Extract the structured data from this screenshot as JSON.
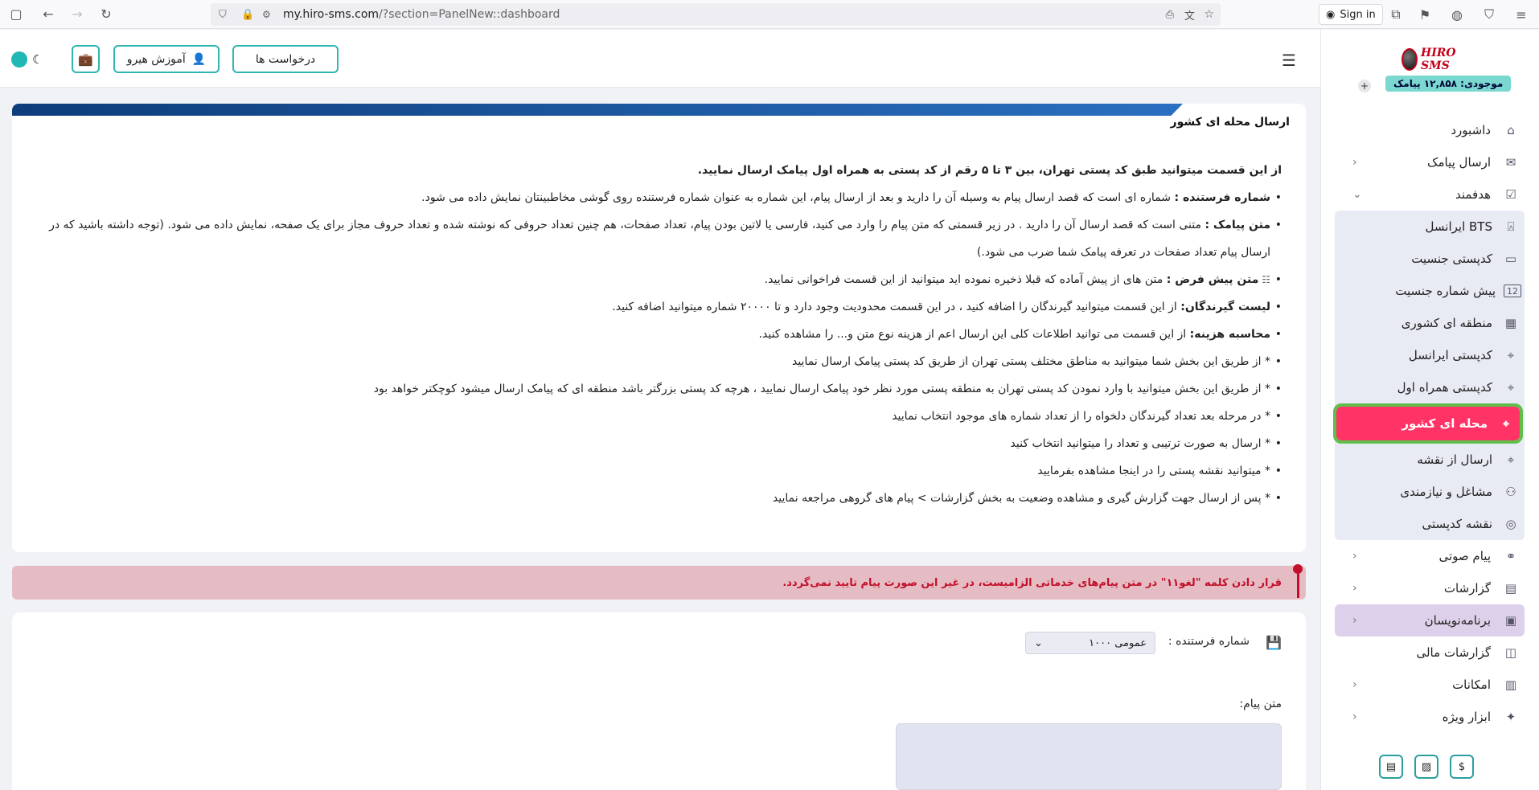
{
  "browser": {
    "url_host": "my.hiro-sms.com",
    "url_path": "/?section=PanelNew::dashboard",
    "signin_label": "Sign in"
  },
  "sidebar": {
    "logo_text": "HIRO SMS",
    "balance": "موجودی: ۱۲,۸۵۸ پیامک",
    "balance_plus": "+",
    "items": [
      {
        "label": "داشبورد",
        "icon": "home-icon"
      },
      {
        "label": "ارسال پیامک",
        "icon": "sms-icon"
      },
      {
        "label": "هدفمند",
        "icon": "target-icon"
      }
    ],
    "sub_items": [
      {
        "label": "BTS ایرانسل",
        "icon": "antenna-icon"
      },
      {
        "label": "کدپستی جنسیت",
        "icon": "id-card-icon"
      },
      {
        "label": "پیش شماره جنسیت",
        "icon": "number-icon"
      },
      {
        "label": "منطقه ای کشوری",
        "icon": "map-icon"
      },
      {
        "label": "کدپستی ایرانسل",
        "icon": "map-pin-icon"
      },
      {
        "label": "کدپستی همراه اول",
        "icon": "map-pin-icon"
      },
      {
        "label": "محله ای کشور",
        "icon": "map-pin-icon"
      },
      {
        "label": "ارسال از نقشه",
        "icon": "map-pin-icon"
      },
      {
        "label": "مشاغل و نیازمندی",
        "icon": "people-icon"
      },
      {
        "label": "نقشه کدپستی",
        "icon": "globe-icon"
      }
    ],
    "after_items": [
      {
        "label": "پیام صوتی",
        "icon": "voicemail-icon"
      },
      {
        "label": "گزارشات",
        "icon": "report-icon"
      },
      {
        "label": "برنامه‌نویسان",
        "icon": "code-icon"
      },
      {
        "label": "گزارشات مالی",
        "icon": "finance-icon"
      },
      {
        "label": "امکانات",
        "icon": "tools-icon"
      },
      {
        "label": "ابزار ویژه",
        "icon": "sparkle-icon"
      }
    ],
    "bottom_buttons": [
      "$"
    ]
  },
  "topbar": {
    "requests_label": "درخواست ها",
    "training_label": "آموزش هیرو"
  },
  "card1": {
    "title": "ارسال محله ای کشور",
    "lead": "از این قسمت میتوانید طبق کد پستی تهران، بین ۳ تا ۵ رقم از کد پستی به همراه اول پیامک ارسال نمایید.",
    "bullets": [
      {
        "b": "شماره فرستنده :",
        "t": " شماره ای است که قصد ارسال پیام به وسیله آن را دارید و بعد از ارسال پیام، این شماره به عنوان شماره فرستنده روی گوشی مخاطبینتان نمایش داده می شود."
      },
      {
        "b": "متن پیامک :",
        "t": " متنی است که قصد ارسال آن را دارید . در زیر قسمتی که متن پیام را وارد می کنید، فارسی یا لاتین بودن پیام، تعداد صفحات، هم چنین تعداد حروفی که نوشته شده و تعداد حروف مجاز برای یک صفحه، نمایش داده می شود. (توجه داشته باشید که در ارسال پیام تعداد صفحات در تعرفه پیامک شما ضرب می شود.)"
      },
      {
        "b": "متن پیش فرض :",
        "t": " متن های از پیش آماده که قبلا ذخیره نموده اید میتوانید از این قسمت فراخوانی نمایید."
      },
      {
        "b": "لیست گیرندگان:",
        "t": " از این قسمت میتوانید گیرندگان را اضافه کنید ، در این قسمت محدودیت وجود دارد و تا ۲۰۰۰۰ شماره میتوانید اضافه کنید."
      },
      {
        "b": "محاسبه هزینه:",
        "t": " از این قسمت می توانید اطلاعات کلی این ارسال اعم از هزینه نوع متن و... را مشاهده کنید."
      },
      {
        "b": "",
        "t": "* از طریق این بخش شما میتوانید به مناطق مختلف پستی تهران از طریق کد پستی پیامک ارسال نمایید"
      },
      {
        "b": "",
        "t": "* از طریق این بخش میتوانید با وارد نمودن کد پستی تهران به منطقه پستی مورد نظر خود پیامک ارسال نمایید ، هرچه کد پستی بزرگتر باشد منطقه ای که پیامک ارسال میشود کوچکتر خواهد بود"
      },
      {
        "b": "",
        "t": "* در مرحله بعد تعداد گیرندگان دلخواه را از تعداد شماره های موجود انتخاب نمایید"
      },
      {
        "b": "",
        "t": "* ارسال به صورت ترتیبی و تعداد را میتوانید انتخاب کنید"
      },
      {
        "b": "",
        "t": "* میتوانید نقشه پستی را در اینجا مشاهده بفرمایید"
      },
      {
        "b": "",
        "t": "* پس از ارسال جهت گزارش گیری و مشاهده وضعیت به بخش گزارشات > پیام های گروهی مراجعه نمایید"
      }
    ]
  },
  "alert": {
    "text": "قرار دادن کلمه \"لغو۱۱\" در متن پیام‌های خدماتی الزامیست، در غیر این صورت پیام تایید نمی‌گردد."
  },
  "card2": {
    "sender_label": "شماره فرستنده :",
    "sender_value": "عمومی ۱۰۰۰",
    "message_label": "متن پیام:"
  },
  "colors": {
    "accent_teal": "#2fb6b1",
    "active_pink": "#ff3366",
    "highlight_green": "#5fbf4a",
    "alert_red": "#c2102a",
    "band_blue": "#0d3d7a"
  }
}
